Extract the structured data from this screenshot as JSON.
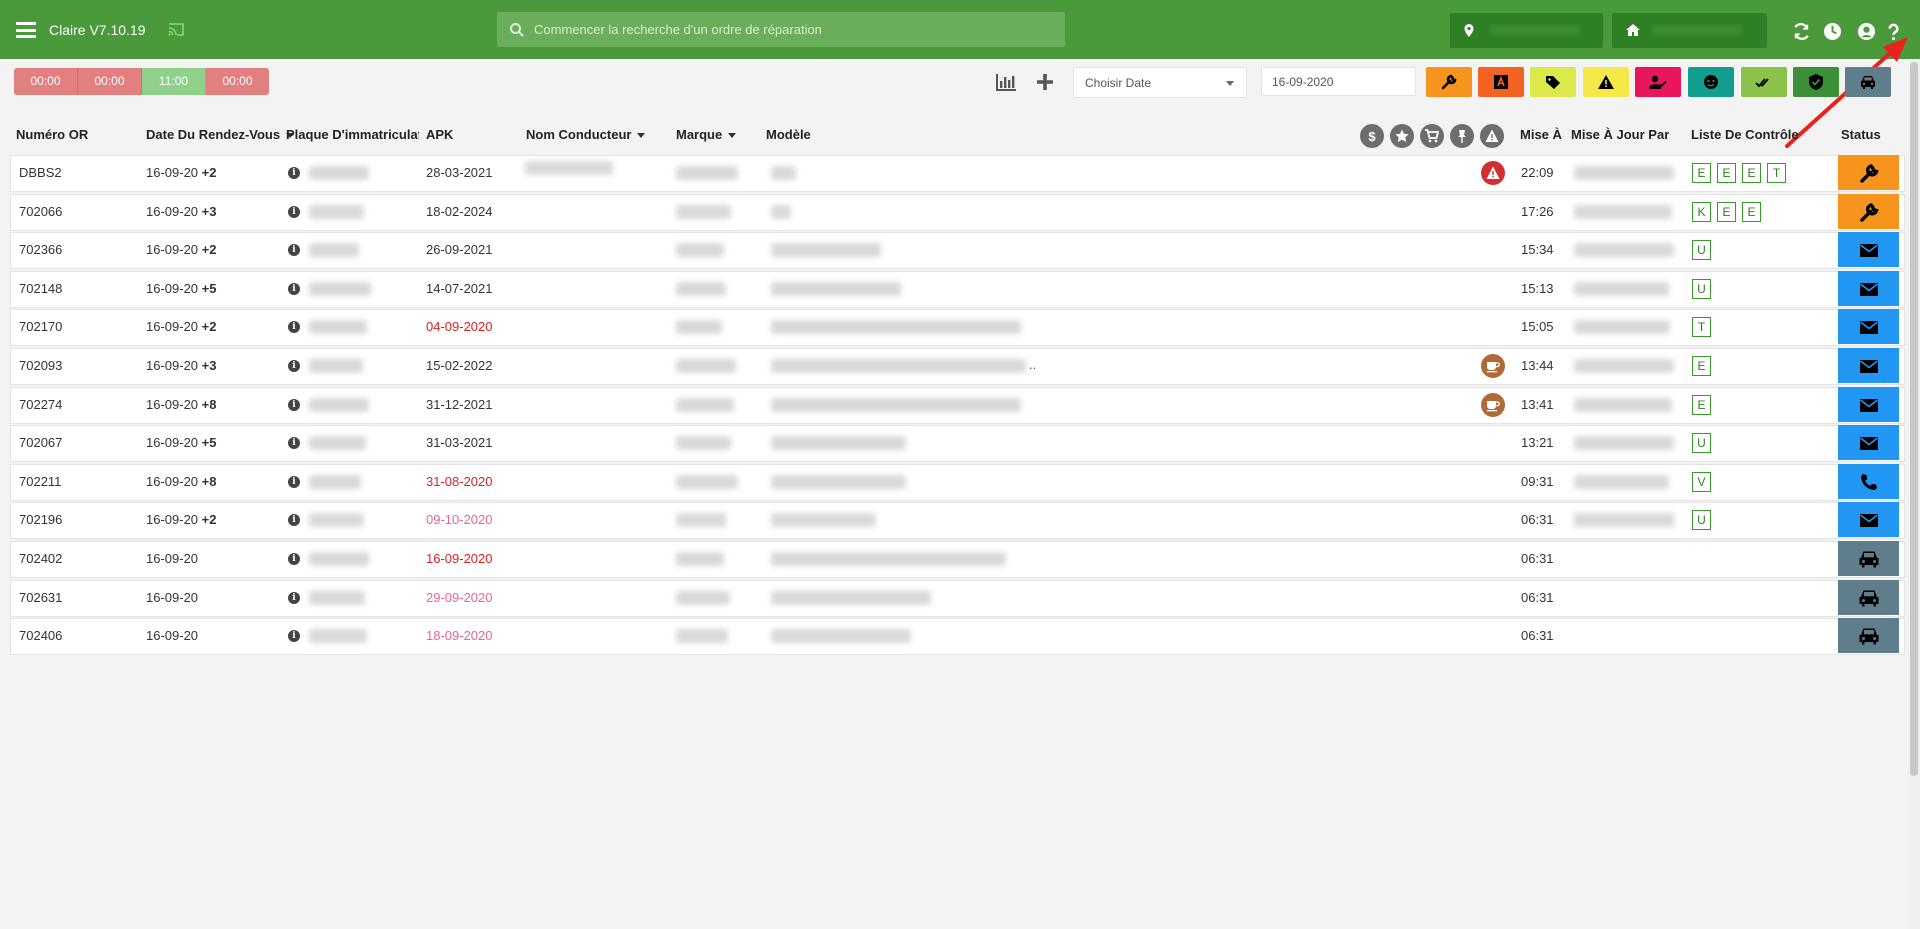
{
  "app": {
    "title": "Claire V7.10.19"
  },
  "search": {
    "placeholder": "Commencer la recherche d'un ordre de réparation"
  },
  "timers": [
    {
      "label": "00:00",
      "color": "#e27f7f"
    },
    {
      "label": "00:00",
      "color": "#e27f7f"
    },
    {
      "label": "11:00",
      "color": "#8fd08a"
    },
    {
      "label": "00:00",
      "color": "#e27f7f"
    }
  ],
  "toolbar": {
    "date_select_label": "Choisir Date",
    "date_value": "16-09-2020"
  },
  "filters": [
    {
      "icon": "wrench-icon",
      "color": "#f7941d"
    },
    {
      "icon": "letter-a-icon",
      "color": "#f26322"
    },
    {
      "icon": "tag-icon",
      "color": "#dce94a"
    },
    {
      "icon": "warning-icon",
      "color": "#f5e94a"
    },
    {
      "icon": "user-check-icon",
      "color": "#e8175d"
    },
    {
      "icon": "face-icon",
      "color": "#129e8e"
    },
    {
      "icon": "double-check-icon",
      "color": "#8bc34a"
    },
    {
      "icon": "shield-check-icon",
      "color": "#3a8f37"
    },
    {
      "icon": "car-icon",
      "color": "#607d8b"
    }
  ],
  "columns": {
    "numero": "Numéro OR",
    "date": "Date Du Rendez-Vous",
    "plaque": "Plaque D'immatriculatio",
    "apk": "APK",
    "conducteur": "Nom Conducteur",
    "marque": "Marque",
    "modele": "Modèle",
    "mise_a": "Mise À",
    "mise_a_jour": "Mise À Jour Par",
    "liste": "Liste De Contrôle",
    "status": "Status"
  },
  "colors": {
    "status_wrench": "#f7941d",
    "status_mail": "#2196f3",
    "status_car": "#607d8b",
    "apk_red": "#e02020",
    "apk_pink": "#f06292",
    "alert_red": "#d32f2f",
    "coffee": "#b06a3a"
  },
  "rows": [
    {
      "numero": "DBBS2",
      "date": "16-09-20",
      "plus": "+2",
      "apk": "28-03-2021",
      "apk_color": "#333",
      "mise_a": "22:09",
      "badges": [
        "E",
        "E",
        "E",
        "T"
      ],
      "status": "wrench",
      "marker": "alert"
    },
    {
      "numero": "702066",
      "date": "16-09-20",
      "plus": "+3",
      "apk": "18-02-2024",
      "apk_color": "#333",
      "mise_a": "17:26",
      "badges": [
        "K",
        "E",
        "E"
      ],
      "status": "wrench",
      "marker": ""
    },
    {
      "numero": "702366",
      "date": "16-09-20",
      "plus": "+2",
      "apk": "26-09-2021",
      "apk_color": "#333",
      "mise_a": "15:34",
      "badges": [
        "U"
      ],
      "status": "mail",
      "marker": ""
    },
    {
      "numero": "702148",
      "date": "16-09-20",
      "plus": "+5",
      "apk": "14-07-2021",
      "apk_color": "#333",
      "mise_a": "15:13",
      "badges": [
        "U"
      ],
      "status": "mail",
      "marker": ""
    },
    {
      "numero": "702170",
      "date": "16-09-20",
      "plus": "+2",
      "apk": "04-09-2020",
      "apk_color": "#e02020",
      "mise_a": "15:05",
      "badges": [
        "T"
      ],
      "status": "mail",
      "marker": ""
    },
    {
      "numero": "702093",
      "date": "16-09-20",
      "plus": "+3",
      "apk": "15-02-2022",
      "apk_color": "#333",
      "mise_a": "13:44",
      "badges": [
        "E"
      ],
      "status": "mail",
      "marker": "coffee",
      "ellipsis": ".."
    },
    {
      "numero": "702274",
      "date": "16-09-20",
      "plus": "+8",
      "apk": "31-12-2021",
      "apk_color": "#333",
      "mise_a": "13:41",
      "badges": [
        "E"
      ],
      "status": "mail",
      "marker": "coffee"
    },
    {
      "numero": "702067",
      "date": "16-09-20",
      "plus": "+5",
      "apk": "31-03-2021",
      "apk_color": "#333",
      "mise_a": "13:21",
      "badges": [
        "U"
      ],
      "status": "mail",
      "marker": ""
    },
    {
      "numero": "702211",
      "date": "16-09-20",
      "plus": "+8",
      "apk": "31-08-2020",
      "apk_color": "#e02020",
      "mise_a": "09:31",
      "badges": [
        "V"
      ],
      "status": "phone",
      "marker": ""
    },
    {
      "numero": "702196",
      "date": "16-09-20",
      "plus": "+2",
      "apk": "09-10-2020",
      "apk_color": "#f06292",
      "mise_a": "06:31",
      "badges": [
        "U"
      ],
      "status": "mail",
      "marker": ""
    },
    {
      "numero": "702402",
      "date": "16-09-20",
      "plus": "",
      "apk": "16-09-2020",
      "apk_color": "#e02020",
      "mise_a": "06:31",
      "badges": [],
      "status": "car",
      "marker": ""
    },
    {
      "numero": "702631",
      "date": "16-09-20",
      "plus": "",
      "apk": "29-09-2020",
      "apk_color": "#f06292",
      "mise_a": "06:31",
      "badges": [],
      "status": "car",
      "marker": ""
    },
    {
      "numero": "702406",
      "date": "16-09-20",
      "plus": "",
      "apk": "18-09-2020",
      "apk_color": "#f06292",
      "mise_a": "06:31",
      "badges": [],
      "status": "car",
      "marker": ""
    }
  ]
}
